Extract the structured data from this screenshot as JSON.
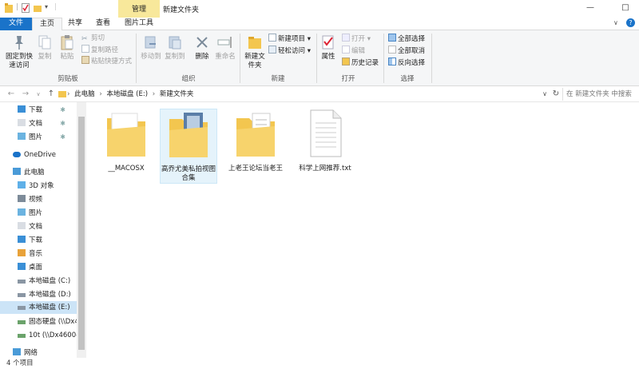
{
  "titlebar": {
    "context_tab": "管理",
    "title": "新建文件夹",
    "minimize": "—",
    "maximize": "□"
  },
  "tabs": {
    "file": "文件",
    "home": "主页",
    "share": "共享",
    "view": "查看",
    "picture_tools": "图片工具"
  },
  "ribbon": {
    "clipboard": {
      "pin": "固定到快速访问",
      "copy": "复制",
      "paste": "粘贴",
      "cut": "剪切",
      "copy_path": "复制路径",
      "paste_shortcut": "粘贴快捷方式",
      "label": "剪贴板"
    },
    "organize": {
      "move_to": "移动到",
      "copy_to": "复制到",
      "delete": "删除",
      "rename": "重命名",
      "label": "组织"
    },
    "new": {
      "new_folder": "新建文件夹",
      "new_item": "新建项目",
      "easy_access": "轻松访问",
      "label": "新建"
    },
    "open": {
      "properties": "属性",
      "open": "打开",
      "edit": "编辑",
      "history": "历史记录",
      "label": "打开"
    },
    "select": {
      "select_all": "全部选择",
      "select_none": "全部取消",
      "invert": "反向选择",
      "label": "选择"
    }
  },
  "address": {
    "crumbs": [
      "此电脑",
      "本地磁盘 (E:)",
      "新建文件夹"
    ],
    "search_placeholder": "在 新建文件夹 中搜索"
  },
  "sidebar": {
    "items": [
      {
        "label": "下载",
        "pinned": true
      },
      {
        "label": "文档",
        "pinned": true
      },
      {
        "label": "图片",
        "pinned": true
      },
      {
        "label": "OneDrive"
      },
      {
        "label": "此电脑"
      },
      {
        "label": "3D 对象"
      },
      {
        "label": "视频"
      },
      {
        "label": "图片"
      },
      {
        "label": "文档"
      },
      {
        "label": "下载"
      },
      {
        "label": "音乐"
      },
      {
        "label": "桌面"
      },
      {
        "label": "本地磁盘 (C:)"
      },
      {
        "label": "本地磁盘 (D:)"
      },
      {
        "label": "本地磁盘 (E:)"
      },
      {
        "label": "固态硬盘 (\\\\Dx4"
      },
      {
        "label": "10t (\\\\Dx4600-"
      },
      {
        "label": "网络"
      }
    ]
  },
  "files": [
    {
      "name": "__MACOSX",
      "type": "folder"
    },
    {
      "name": "高乔尤美私拍视图合集",
      "type": "folder-images"
    },
    {
      "name": "上老王论坛当老王",
      "type": "folder-docs"
    },
    {
      "name": "科学上网推荐.txt",
      "type": "txt"
    }
  ],
  "status": {
    "count": "4 个项目"
  },
  "colors": {
    "accent": "#1a73c9",
    "folder": "#f3c64f",
    "context_tab": "#f8e89b",
    "selection": "#cce4f7"
  }
}
